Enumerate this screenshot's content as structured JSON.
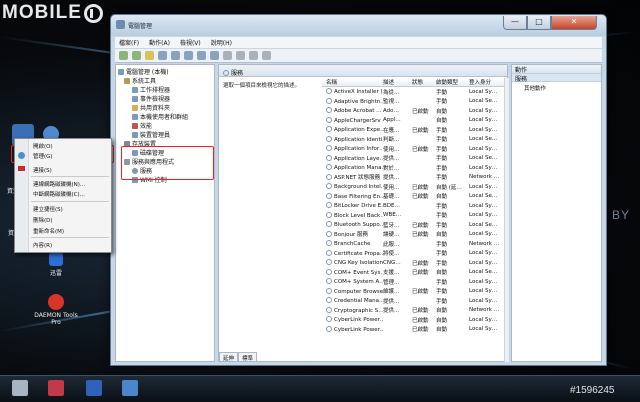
{
  "branding": {
    "logo_text": "MOBILE",
    "watermark_by": "BY",
    "watermark_id": "#1596245"
  },
  "desktop": {
    "icons": [
      {
        "label": "資源",
        "color": "#3a6fb5"
      },
      {
        "label": "資",
        "color": "#4a78c0"
      },
      {
        "label": "迅雷",
        "color": "#2d6fd8"
      },
      {
        "label": "DAEMON Tools Pro",
        "color": "#d8342a"
      }
    ]
  },
  "window": {
    "title": "電腦管理",
    "buttons": {
      "min": "—",
      "max": "□",
      "close": "✕"
    },
    "menu": [
      "檔案(F)",
      "動作(A)",
      "檢視(V)",
      "說明(H)"
    ]
  },
  "tree": {
    "items": [
      {
        "label": "電腦管理 (本機)",
        "indent": 0
      },
      {
        "label": "系統工具",
        "indent": 1
      },
      {
        "label": "工作排程器",
        "indent": 2
      },
      {
        "label": "事件檢視器",
        "indent": 2
      },
      {
        "label": "共用資料夾",
        "indent": 2
      },
      {
        "label": "本機使用者和群組",
        "indent": 2
      },
      {
        "label": "效能",
        "indent": 2
      },
      {
        "label": "裝置管理員",
        "indent": 2
      },
      {
        "label": "存放裝置",
        "indent": 1
      },
      {
        "label": "磁碟管理",
        "indent": 2
      },
      {
        "label": "服務與應用程式",
        "indent": 1
      },
      {
        "label": "服務",
        "indent": 2
      },
      {
        "label": "WMI 控制",
        "indent": 2
      }
    ]
  },
  "services": {
    "header": "服務",
    "description": "選取一個項目來檢視它的描述。",
    "columns": [
      "名稱",
      "描述",
      "狀態",
      "啟動類型",
      "登入身分"
    ],
    "rows": [
      [
        "ActiveX Installer (…",
        "為從…",
        "",
        "手動",
        "Local Sy…"
      ],
      [
        "Adaptive Brightn…",
        "監視…",
        "",
        "手動",
        "Local Se…"
      ],
      [
        "Adobe Acrobat …",
        "Ado…",
        "已啟動",
        "自動",
        "Local Sy…"
      ],
      [
        "AppleChargerSrv",
        "Appl…",
        "",
        "自動",
        "Local Sy…"
      ],
      [
        "Application Expe…",
        "在應…",
        "已啟動",
        "手動",
        "Local Sy…"
      ],
      [
        "Application Identi…",
        "判斷…",
        "",
        "手動",
        "Local Se…"
      ],
      [
        "Application Infor…",
        "使用…",
        "已啟動",
        "手動",
        "Local Sy…"
      ],
      [
        "Application Laye…",
        "提供…",
        "",
        "手動",
        "Local Se…"
      ],
      [
        "Application Mana…",
        "對於…",
        "",
        "手動",
        "Local Sy…"
      ],
      [
        "ASP.NET 狀態服務",
        "提供…",
        "",
        "手動",
        "Network …"
      ],
      [
        "Background Intel…",
        "使用…",
        "已啟動",
        "自動 (延…",
        "Local Sy…"
      ],
      [
        "Base Filtering En…",
        "基礎…",
        "已啟動",
        "自動",
        "Local Se…"
      ],
      [
        "BitLocker Drive E…",
        "BDE…",
        "",
        "手動",
        "Local Sy…"
      ],
      [
        "Block Level Back…",
        "WBE…",
        "",
        "手動",
        "Local Sy…"
      ],
      [
        "Bluetooth Suppo…",
        "藍牙…",
        "已啟動",
        "手動",
        "Local Se…"
      ],
      [
        "Bonjour 服務",
        "讓硬…",
        "已啟動",
        "自動",
        "Local Sy…"
      ],
      [
        "BranchCache",
        "此服…",
        "",
        "手動",
        "Network …"
      ],
      [
        "Certificate Propa…",
        "將使…",
        "",
        "手動",
        "Local Sy…"
      ],
      [
        "CNG Key Isolation",
        "CNG…",
        "已啟動",
        "手動",
        "Local Sy…"
      ],
      [
        "COM+ Event Sys…",
        "支援…",
        "已啟動",
        "自動",
        "Local Se…"
      ],
      [
        "COM+ System A…",
        "管理…",
        "",
        "手動",
        "Local Sy…"
      ],
      [
        "Computer Browser",
        "維護…",
        "已啟動",
        "手動",
        "Local Sy…"
      ],
      [
        "Credential Mana…",
        "提供…",
        "",
        "手動",
        "Local Sy…"
      ],
      [
        "Cryptographic S…",
        "提供…",
        "已啟動",
        "自動",
        "Network …"
      ],
      [
        "CyberLink Power…",
        "",
        "已啟動",
        "自動",
        "Local Sy…"
      ],
      [
        "CyberLink Power…",
        "",
        "已啟動",
        "自動",
        "Local Sy…"
      ]
    ],
    "tabs": [
      "延伸",
      "標準"
    ]
  },
  "actions": {
    "header": "動作",
    "section": "服務",
    "more": "其他動作"
  },
  "context_menu": {
    "items": [
      "開啟(O)",
      "管理(G)",
      "連接(S)",
      "連線網路磁碟機(N)...",
      "中斷網路磁碟機(C)...",
      "建立捷徑(S)",
      "刪除(D)",
      "重新命名(M)",
      "內容(R)"
    ]
  },
  "colors": {
    "highlight_box": "#e22222",
    "window_frame": "#c7d7e6"
  }
}
